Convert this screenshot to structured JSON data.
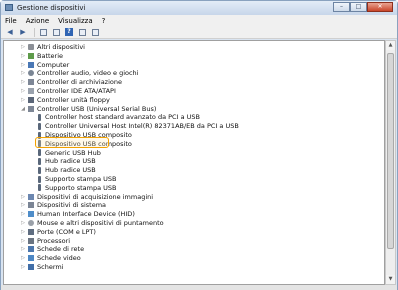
{
  "window": {
    "title": "Gestione dispositivi",
    "caption_minimize": "–",
    "caption_maximize": "□",
    "caption_close": "✕"
  },
  "menubar": {
    "items": [
      "File",
      "Azione",
      "Visualizza",
      "?"
    ]
  },
  "toolbar": {
    "back_glyph": "◀",
    "forward_glyph": "▶",
    "help_glyph": "?"
  },
  "tree": {
    "items": [
      {
        "label": "Altri dispositivi",
        "icon": "folder-icon",
        "expander": "▷"
      },
      {
        "label": "Batterie",
        "icon": "battery-icon",
        "expander": "▷"
      },
      {
        "label": "Computer",
        "icon": "computer-icon",
        "expander": "▷"
      },
      {
        "label": "Controller audio, video e giochi",
        "icon": "audio-icon",
        "expander": "▷"
      },
      {
        "label": "Controller di archiviazione",
        "icon": "storage-icon",
        "expander": "▷"
      },
      {
        "label": "Controller IDE ATA/ATAPI",
        "icon": "disk-icon",
        "expander": "▷"
      },
      {
        "label": "Controller unità floppy",
        "icon": "floppy-icon",
        "expander": "▷"
      },
      {
        "label": "Controller USB (Universal Serial Bus)",
        "icon": "usb-controller-icon",
        "expander": "◢"
      },
      {
        "label": "Controller host standard avanzato da PCI a USB",
        "icon": "usb-device-icon",
        "expander": ""
      },
      {
        "label": "Controller Universal Host Intel(R) 82371AB/EB da PCI a USB",
        "icon": "usb-device-icon",
        "expander": ""
      },
      {
        "label": "Dispositivo USB composito",
        "icon": "usb-device-icon",
        "expander": ""
      },
      {
        "label": "Dispositivo USB composito",
        "icon": "usb-device-icon",
        "expander": ""
      },
      {
        "label": "Generic USB Hub",
        "icon": "usb-device-icon",
        "expander": ""
      },
      {
        "label": "Hub radice USB",
        "icon": "usb-device-icon",
        "expander": ""
      },
      {
        "label": "Hub radice USB",
        "icon": "usb-device-icon",
        "expander": ""
      },
      {
        "label": "Supporto stampa USB",
        "icon": "usb-device-icon",
        "expander": ""
      },
      {
        "label": "Supporto stampa USB",
        "icon": "usb-device-icon",
        "expander": ""
      },
      {
        "label": "Dispositivi di acquisizione immagini",
        "icon": "imaging-icon",
        "expander": "▷"
      },
      {
        "label": "Dispositivi di sistema",
        "icon": "system-icon",
        "expander": "▷"
      },
      {
        "label": "Human Interface Device (HID)",
        "icon": "hid-icon",
        "expander": "▷"
      },
      {
        "label": "Mouse e altri dispositivi di puntamento",
        "icon": "mouse-icon",
        "expander": "▷"
      },
      {
        "label": "Porte (COM e LPT)",
        "icon": "port-icon",
        "expander": "▷"
      },
      {
        "label": "Processori",
        "icon": "cpu-icon",
        "expander": "▷"
      },
      {
        "label": "Schede di rete",
        "icon": "network-icon",
        "expander": "▷"
      },
      {
        "label": "Schede video",
        "icon": "video-icon",
        "expander": "▷"
      },
      {
        "label": "Schermi",
        "icon": "screen-icon",
        "expander": "▷"
      }
    ],
    "highlight_color": "#f2a100"
  },
  "scrollbar": {
    "up_glyph": "▲",
    "down_glyph": "▼"
  }
}
